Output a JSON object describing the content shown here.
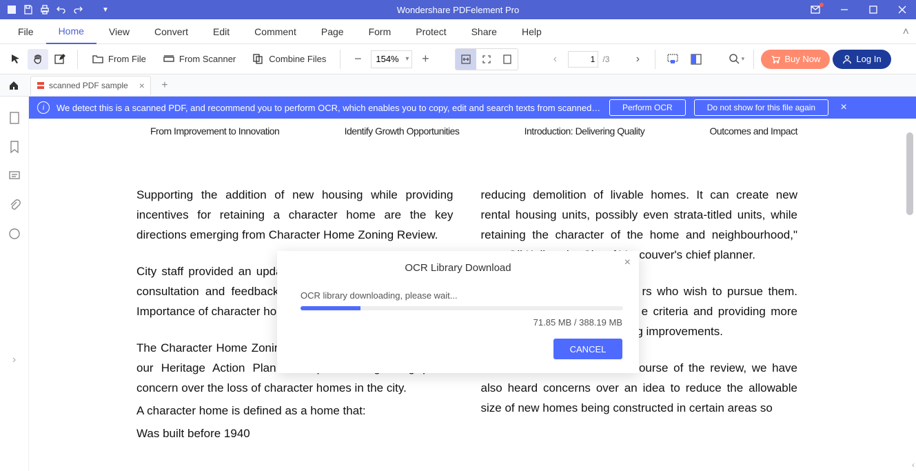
{
  "titlebar": {
    "title": "Wondershare PDFelement Pro"
  },
  "menubar": {
    "items": [
      {
        "label": "File",
        "active": false
      },
      {
        "label": "Home",
        "active": true
      },
      {
        "label": "View",
        "active": false
      },
      {
        "label": "Convert",
        "active": false
      },
      {
        "label": "Edit",
        "active": false
      },
      {
        "label": "Comment",
        "active": false
      },
      {
        "label": "Page",
        "active": false
      },
      {
        "label": "Form",
        "active": false
      },
      {
        "label": "Protect",
        "active": false
      },
      {
        "label": "Share",
        "active": false
      },
      {
        "label": "Help",
        "active": false
      }
    ]
  },
  "toolbar": {
    "from_file": "From File",
    "from_scanner": "From Scanner",
    "combine_files": "Combine Files",
    "zoom": "154%",
    "page_current": "1",
    "page_total": "/3",
    "buy": "Buy Now",
    "login": "Log In"
  },
  "tabs": {
    "doc_name": "scanned PDF sample"
  },
  "banner": {
    "text": "We detect this is a scanned PDF, and recommend you to perform OCR, which enables you to copy, edit and search texts from scanned PDF d...",
    "perform": "Perform OCR",
    "dismiss": "Do not show for this file again"
  },
  "page_headings": {
    "h1": "From Improvement to Innovation",
    "h2": "Identify Growth Opportunities",
    "h3": "Introduction: Delivering Quality",
    "h4": "Outcomes and Impact"
  },
  "page_body": {
    "c1p1": "Supporting the addition of new housing while providing incentives for retaining a character home are the key directions emerging from Character Home Zoning Review.",
    "c1p2": "City staff provided an update the main highlights of what v consultation and feedback consultants, and analysis by s Importance of character hom",
    "c1p3": "The Character Home Zoning Review was initiated as part of our Heritage Action Plan in response to growing public concern over the loss of character homes in the city.",
    "c1p4": "A character home is defined as a home that:",
    "c1p5": "Was built before 1940",
    "c2p1": "reducing demolition of livable homes.  It can create new rental housing units, possibly even strata-titled units, while retaining the character of the home and neighbourhood,\" says Gil Kelley, the City of Vancouver's chief planner.",
    "c2p2": "trong support for these kinds rs who wish to pursue them. explored include refining and e criteria and providing more grant programs and processing improvements.",
    "c2p3": "What we've heard over the course of the review, we have also heard concerns over an idea to reduce the allowable size of new homes being constructed in certain areas so"
  },
  "dialog": {
    "title": "OCR Library Download",
    "message": "OCR library downloading, please wait...",
    "progress_text": "71.85 MB / 388.19 MB",
    "cancel": "CANCEL"
  }
}
